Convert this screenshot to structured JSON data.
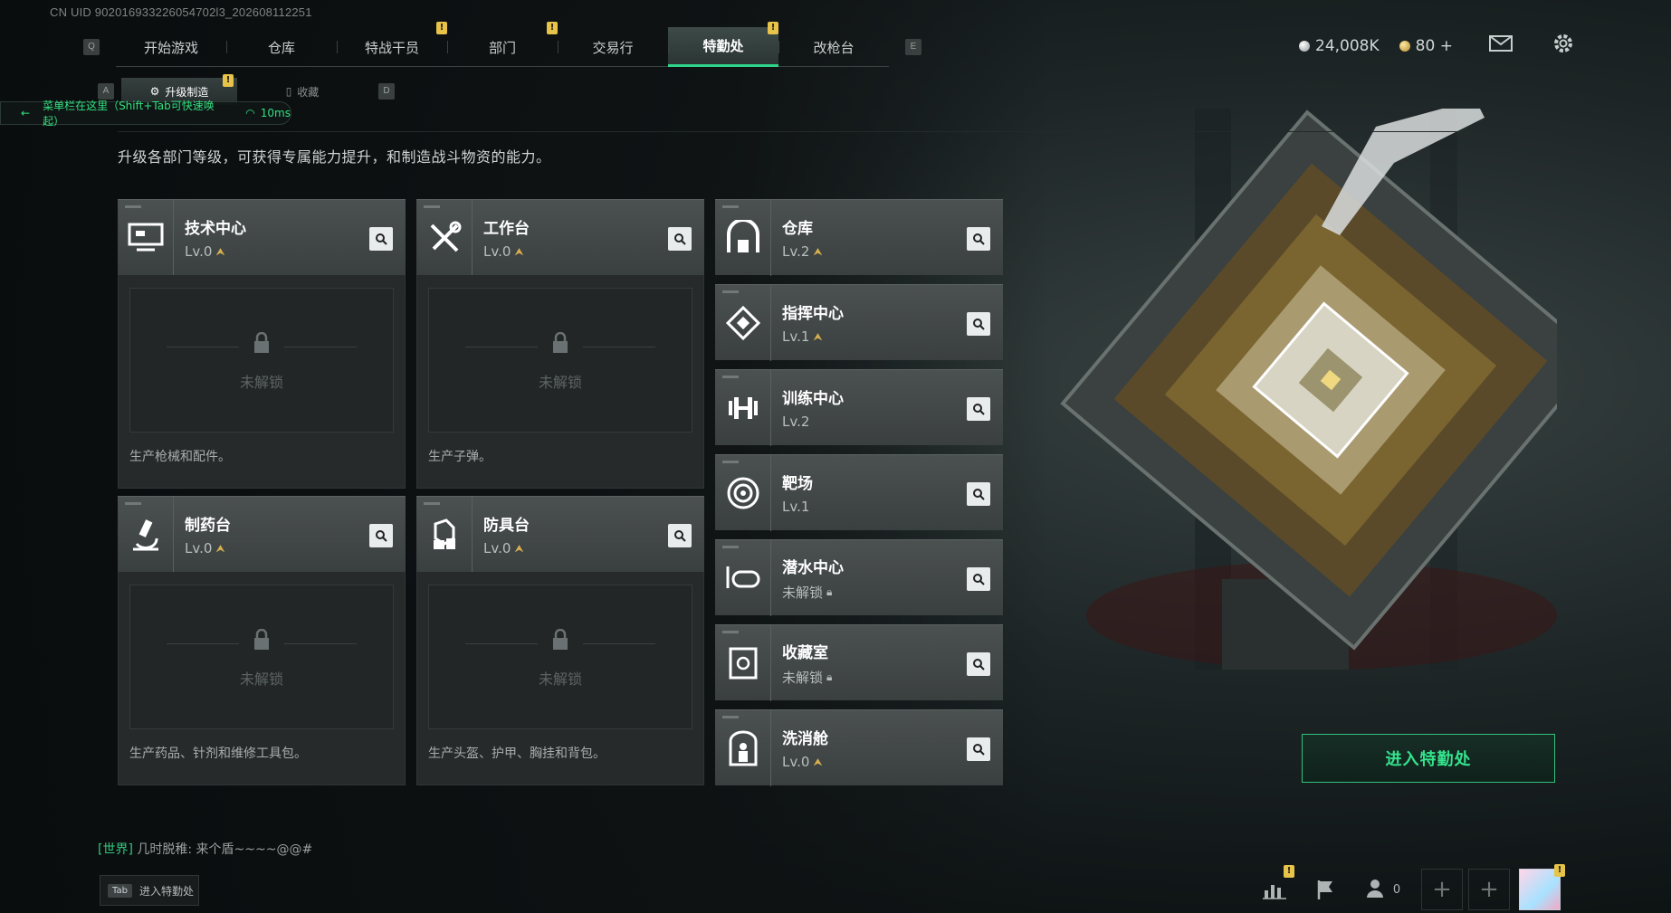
{
  "uid_text": "CN UID 902016933226054702l3_202608112251",
  "top_tabs": {
    "left_hotkey": "Q",
    "right_hotkey": "E",
    "items": [
      {
        "label": "开始游戏",
        "warn": false,
        "active": false
      },
      {
        "label": "仓库",
        "warn": false,
        "active": false
      },
      {
        "label": "特战干员",
        "warn": true,
        "active": false
      },
      {
        "label": "部门",
        "warn": true,
        "active": false
      },
      {
        "label": "交易行",
        "warn": false,
        "active": false
      },
      {
        "label": "特勤处",
        "warn": true,
        "active": true
      },
      {
        "label": "改枪台",
        "warn": false,
        "active": false
      }
    ]
  },
  "currency": {
    "silver": "24,008K",
    "gold": "80",
    "gold_plus": "+"
  },
  "sub_tabs": {
    "left_hotkey": "A",
    "right_hotkey": "D",
    "items": [
      {
        "label": "升级制造",
        "active": true,
        "warn": true
      },
      {
        "label": "收藏",
        "active": false,
        "warn": false
      }
    ]
  },
  "net_banner": {
    "text": "菜单栏在这里（Shift+Tab可快速唤起）",
    "ping": "10ms"
  },
  "description": "升级各部门等级，可获得专属能力提升，和制造战斗物资的能力。",
  "big_cards": [
    {
      "name": "技术中心",
      "level": "Lv.0",
      "icon": "monitor-icon",
      "locked_text": "未解锁",
      "desc": "生产枪械和配件。"
    },
    {
      "name": "工作台",
      "level": "Lv.0",
      "icon": "tools-icon",
      "locked_text": "未解锁",
      "desc": "生产子弹。"
    },
    {
      "name": "制药台",
      "level": "Lv.0",
      "icon": "microscope-icon",
      "locked_text": "未解锁",
      "desc": "生产药品、针剂和维修工具包。"
    },
    {
      "name": "防具台",
      "level": "Lv.0",
      "icon": "armor-icon",
      "locked_text": "未解锁",
      "desc": "生产头盔、护甲、胸挂和背包。"
    }
  ],
  "small_cards": [
    {
      "name": "仓库",
      "level": "Lv.2",
      "icon": "warehouse-icon",
      "upgradable": true,
      "locked": false
    },
    {
      "name": "指挥中心",
      "level": "Lv.1",
      "icon": "command-icon",
      "upgradable": true,
      "locked": false
    },
    {
      "name": "训练中心",
      "level": "Lv.2",
      "icon": "dumbbell-icon",
      "upgradable": false,
      "locked": false
    },
    {
      "name": "靶场",
      "level": "Lv.1",
      "icon": "target-icon",
      "upgradable": false,
      "locked": false
    },
    {
      "name": "潜水中心",
      "level": "未解锁",
      "icon": "diving-mask-icon",
      "upgradable": false,
      "locked": true
    },
    {
      "name": "收藏室",
      "level": "未解锁",
      "icon": "collection-icon",
      "upgradable": false,
      "locked": true
    },
    {
      "name": "洗消舱",
      "level": "Lv.0",
      "icon": "decon-icon",
      "upgradable": true,
      "locked": false
    }
  ],
  "enter_button": "进入特勤处",
  "chat": {
    "channel": "[世界]",
    "message": "几时脱稚: 来个盾~~~~@@#"
  },
  "tab_hint": {
    "key": "Tab",
    "label": "进入特勤处"
  },
  "bottom_right": {
    "friends_count": "0"
  },
  "colors": {
    "accent_green": "#2fd48a",
    "warn_yellow": "#e8c34a",
    "upgrade_gold": "#d7b04f"
  }
}
